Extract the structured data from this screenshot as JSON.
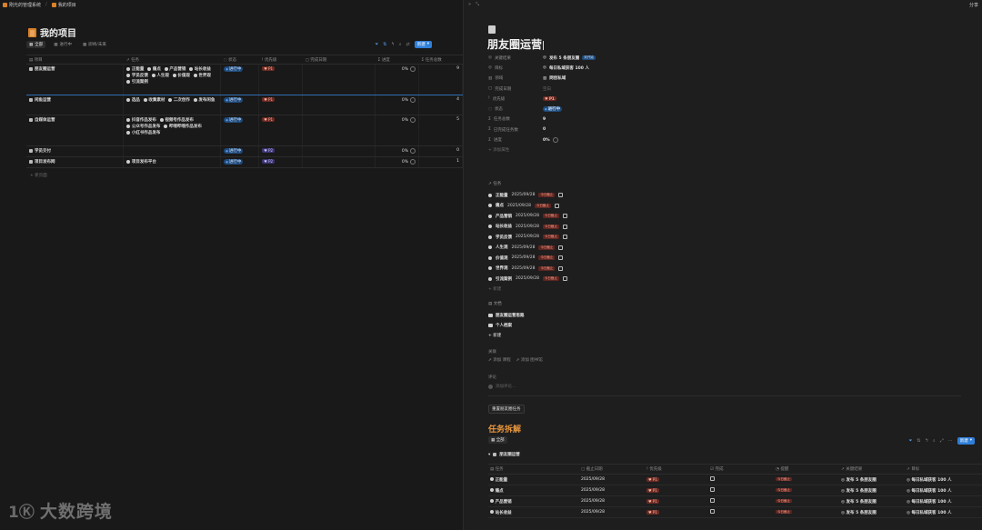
{
  "topbar": {
    "breadcrumb": [
      "刚光的管理系统",
      "我的项目"
    ],
    "share": "分享"
  },
  "page": {
    "title": "我的项目",
    "views": [
      "全部",
      "进行中",
      "即将/未来"
    ],
    "new_button": "新建"
  },
  "table": {
    "headers": [
      "项目",
      "任务",
      "状态",
      "优先级",
      "完成日期",
      "进度",
      "任务总数"
    ],
    "rows": [
      {
        "name": "朋友圈运营",
        "tasks": [
          "正能量",
          "痛点",
          "产品营销",
          "站长收益",
          "学员反馈",
          "人生观",
          "价值观",
          "世界观",
          "引流案例"
        ],
        "status": "进行中",
        "priority": "P1",
        "date": "",
        "progress": "0%",
        "count": "9"
      },
      {
        "name": "闲鱼运营",
        "tasks": [
          "选品",
          "收集素材",
          "二次创作",
          "发布闲鱼"
        ],
        "status": "进行中",
        "priority": "P1",
        "date": "",
        "progress": "0%",
        "count": "4"
      },
      {
        "name": "自媒体运营",
        "tasks": [
          "抖音作品发布",
          "视频号作品发布",
          "公众号作品发布",
          "哔哩哔哩作品发布",
          "小红书作品发布"
        ],
        "status": "进行中",
        "priority": "P1",
        "date": "",
        "progress": "0%",
        "count": "5"
      },
      {
        "name": "学员交付",
        "tasks": [],
        "status": "进行中",
        "priority": "P2",
        "date": "",
        "progress": "0%",
        "count": "0"
      },
      {
        "name": "项目发布网",
        "tasks": [
          "项目发布平台"
        ],
        "status": "进行中",
        "priority": "P2",
        "date": "",
        "progress": "0%",
        "count": "1"
      }
    ],
    "add_row": "+ 新页面"
  },
  "watermark": {
    "logo": "1Ⓚ",
    "text": "大数跨境"
  },
  "detail": {
    "title": "朋友圈运营",
    "props": [
      {
        "key": "关键结果",
        "value": "发布 5 条朋友圈",
        "badge": "未开始"
      },
      {
        "key": "目标",
        "value": "每日私域获客 100 人",
        "badge": ""
      },
      {
        "key": "领域",
        "value": "网创私域",
        "badge": ""
      },
      {
        "key": "完成日期",
        "value": "空白",
        "badge": ""
      },
      {
        "key": "优先级",
        "value": "P1",
        "badge": ""
      },
      {
        "key": "状态",
        "value": "进行中",
        "badge": ""
      },
      {
        "key": "任务总数",
        "value": "9",
        "badge": ""
      },
      {
        "key": "已完成任务数",
        "value": "0",
        "badge": ""
      },
      {
        "key": "进度",
        "value": "0%",
        "badge": ""
      }
    ],
    "add_prop": "+ 添加属性",
    "tasks_label": "任务",
    "tasks": [
      {
        "name": "正能量",
        "date": "2025/09/28",
        "tag": "今日截止"
      },
      {
        "name": "痛点",
        "date": "2025/09/28",
        "tag": "今日截止"
      },
      {
        "name": "产品营销",
        "date": "2025/09/28",
        "tag": "今日截止"
      },
      {
        "name": "站长收益",
        "date": "2025/09/28",
        "tag": "今日截止"
      },
      {
        "name": "学员反馈",
        "date": "2025/09/28",
        "tag": "今日截止"
      },
      {
        "name": "人生观",
        "date": "2025/09/28",
        "tag": "今日截止"
      },
      {
        "name": "价值观",
        "date": "2025/09/28",
        "tag": "今日截止"
      },
      {
        "name": "世界观",
        "date": "2025/09/28",
        "tag": "今日截止"
      },
      {
        "name": "引流案例",
        "date": "2025/09/28",
        "tag": "今日截止"
      }
    ],
    "tasks_new": "+ 新建",
    "docs_label": "文档",
    "docs": [
      "朋友圈运营思路",
      "个人档案"
    ],
    "docs_new": "+ 新建",
    "related_label": "关联",
    "related_items": [
      "添加 课程",
      "添加 图书馆"
    ],
    "comment_label": "评论",
    "comment_placeholder": "添加评论...",
    "reset_button": "重置朋友圈任务",
    "sub_title": "任务拆解",
    "sub_view": "全部",
    "sub_new": "新建",
    "group_name": "朋友圈运营",
    "sub_headers": [
      "任务",
      "截止日期",
      "优先级",
      "完成",
      "提醒",
      "关键结果",
      "目标"
    ],
    "sub_rows": [
      {
        "name": "正能量",
        "date": "2025/09/28",
        "priority": "P1",
        "tag": "今日截止",
        "kr": "发布 5 条朋友圈",
        "goal": "每日私域获客 100 人"
      },
      {
        "name": "痛点",
        "date": "2025/09/28",
        "priority": "P1",
        "tag": "今日截止",
        "kr": "发布 5 条朋友圈",
        "goal": "每日私域获客 100 人"
      },
      {
        "name": "产品营销",
        "date": "2025/09/28",
        "priority": "P1",
        "tag": "今日截止",
        "kr": "发布 5 条朋友圈",
        "goal": "每日私域获客 100 人"
      },
      {
        "name": "站长收益",
        "date": "2025/09/28",
        "priority": "P1",
        "tag": "今日截止",
        "kr": "发布 5 条朋友圈",
        "goal": "每日私域获客 100 人"
      }
    ]
  },
  "colors": {
    "accent": "#2f7fd9",
    "orange": "#e8963e",
    "p1": "#6b2a22",
    "p2": "#3a3470"
  }
}
